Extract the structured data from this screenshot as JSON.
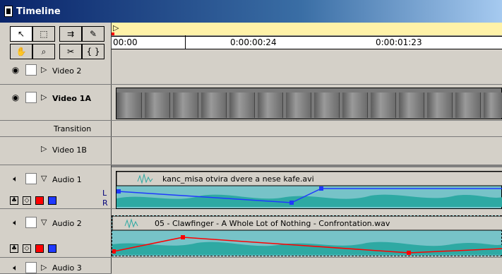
{
  "window": {
    "title": "Timeline"
  },
  "toolbar": {
    "tools": [
      {
        "name": "selection-tool",
        "glyph": "↖"
      },
      {
        "name": "range-select-tool",
        "glyph": "⬚"
      },
      {
        "name": "track-select-tool",
        "glyph": "⇉"
      },
      {
        "name": "pen-tool",
        "glyph": "✎"
      },
      {
        "name": "hand-tool",
        "glyph": "✋"
      },
      {
        "name": "zoom-tool",
        "glyph": "🔍"
      },
      {
        "name": "razor-tool",
        "glyph": "✂"
      },
      {
        "name": "in-out-tool",
        "glyph": "{ }"
      }
    ]
  },
  "ruler": {
    "labels": [
      "00:00",
      "0:00:00:24",
      "0:00:01:23"
    ]
  },
  "tracks": [
    {
      "name": "Video 2",
      "collapsed": true
    },
    {
      "name": "Video 1A",
      "expanded": true
    },
    {
      "name": "Transition"
    },
    {
      "name": "Video 1B",
      "collapsed": true
    },
    {
      "name": "Audio 1",
      "expanded": true,
      "channels": [
        "L",
        "R"
      ]
    },
    {
      "name": "Audio 2",
      "expanded": true
    },
    {
      "name": "Audio 3",
      "collapsed": true
    }
  ],
  "clips": {
    "audio1": {
      "filename": "kanc_misa otvira dvere a nese kafe.avi"
    },
    "audio2": {
      "filename": "05 - Clawfinger - A Whole Lot of Nothing - Confrontation.wav"
    }
  },
  "colors": {
    "titlebar": "#0a246a",
    "audio_clip": "#77c3c8",
    "waveform": "#2ea9a3",
    "volume_line_blue": "#1f39ff",
    "volume_line_red": "#ff0000",
    "work_area": "#fff2a8"
  }
}
